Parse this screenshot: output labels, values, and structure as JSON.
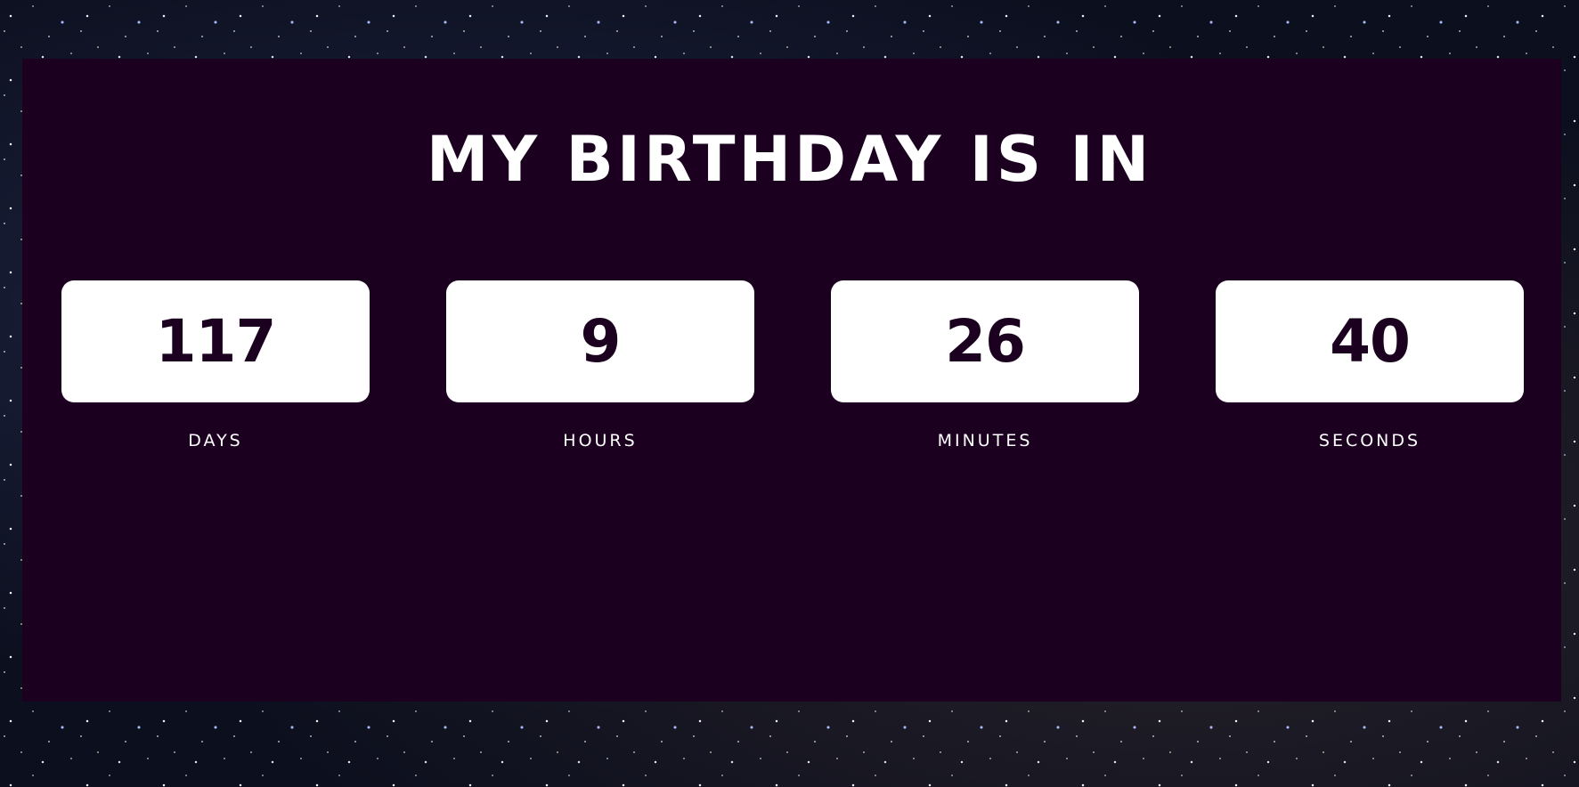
{
  "heading": "MY BIRTHDAY IS IN",
  "countdown": [
    {
      "value": "117",
      "label": "DAYS"
    },
    {
      "value": "9",
      "label": "HOURS"
    },
    {
      "value": "26",
      "label": "MINUTES"
    },
    {
      "value": "40",
      "label": "SECONDS"
    }
  ],
  "colors": {
    "panel": "#1b0020",
    "box": "#ffffff",
    "number": "#1b0020",
    "text": "#ffffff"
  }
}
